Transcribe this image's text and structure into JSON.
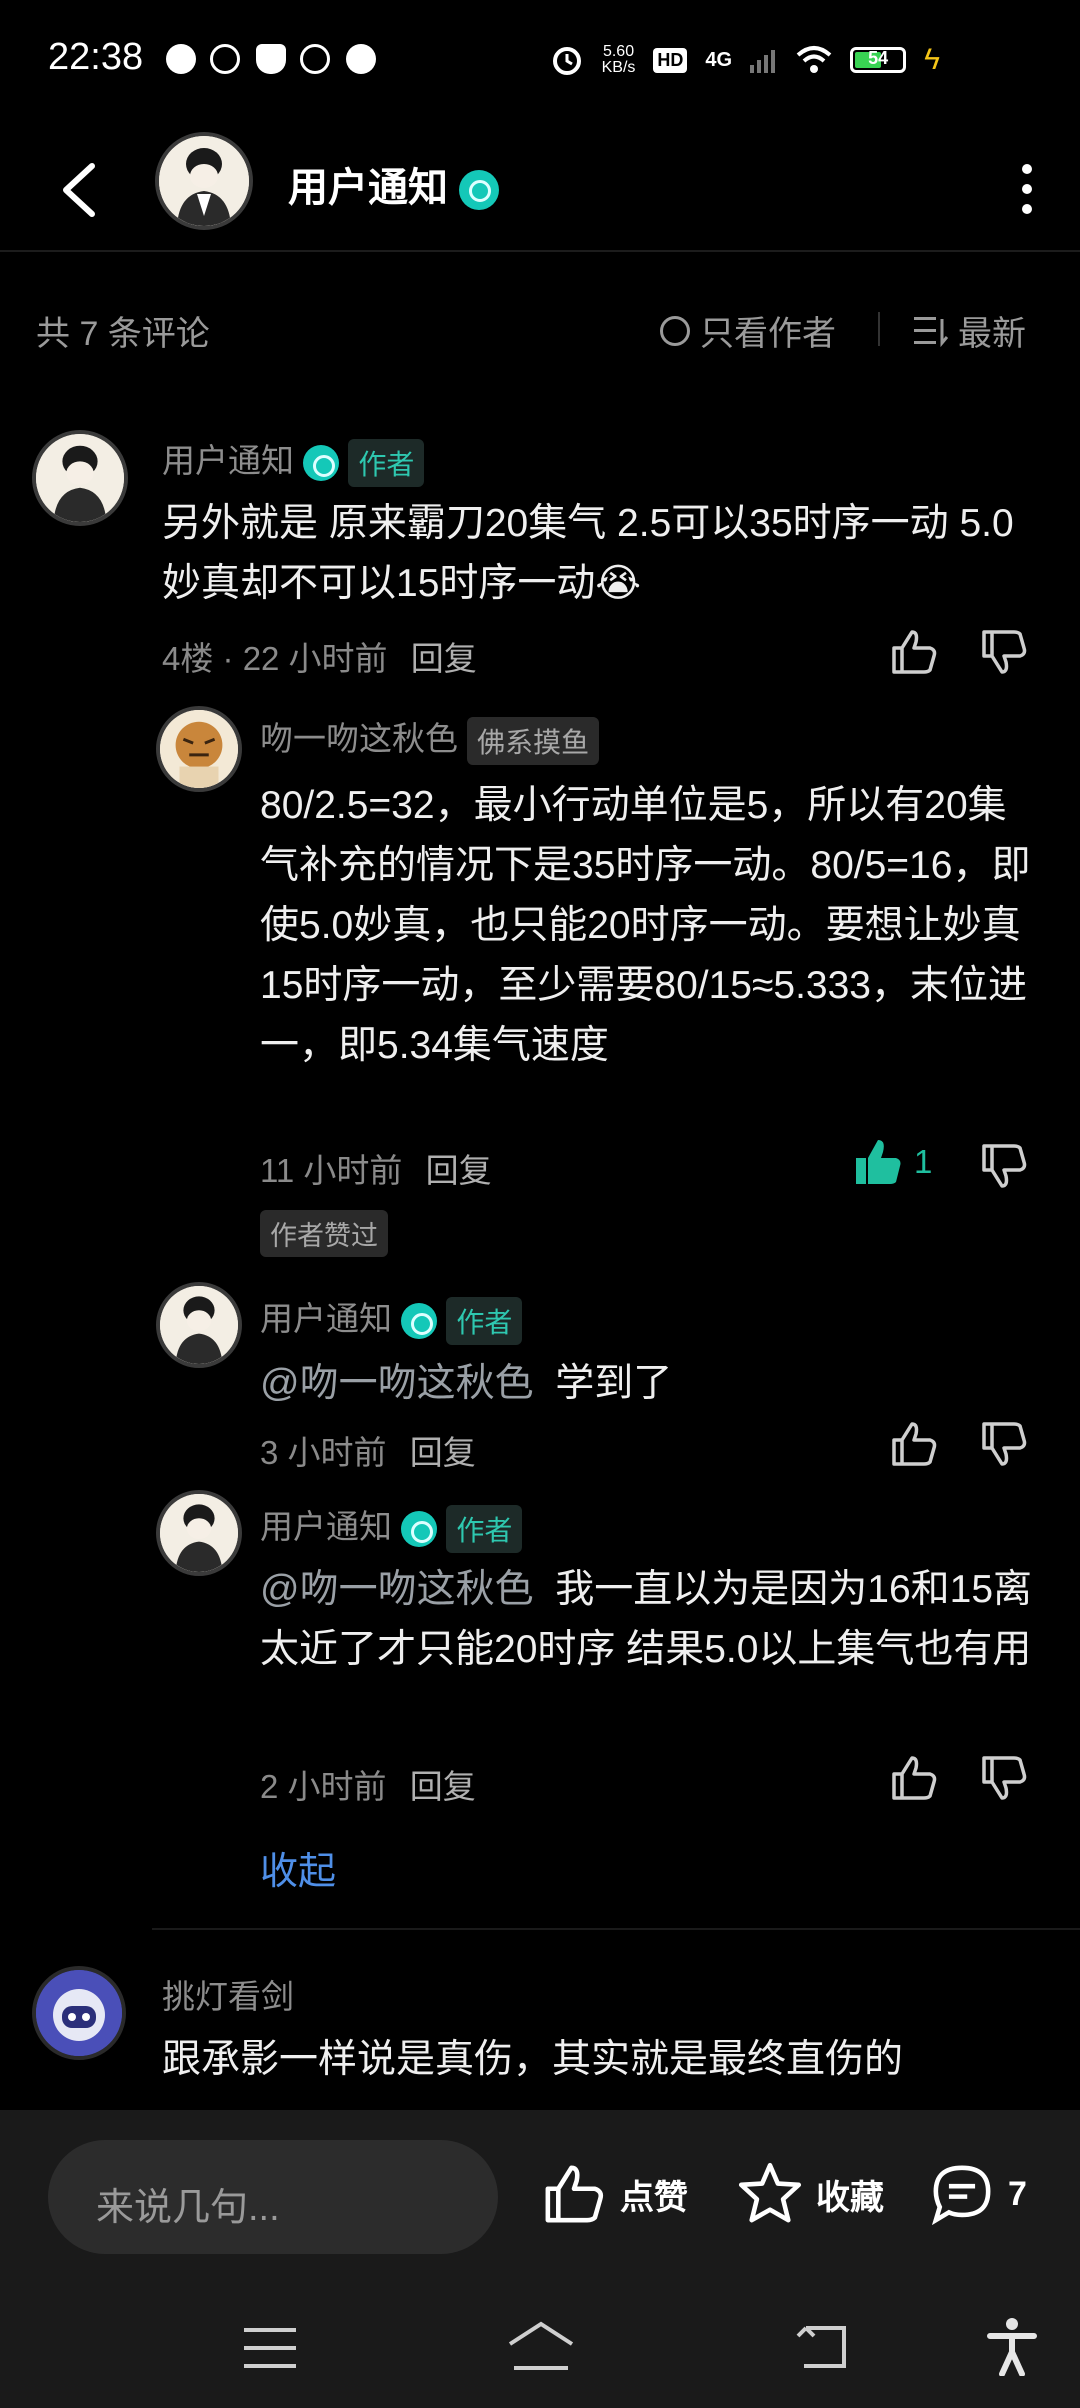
{
  "status_bar": {
    "time": "22:38",
    "net_speed_value": "5.60",
    "net_speed_unit": "KB/s",
    "hd": "HD",
    "network": "4G",
    "battery": "54"
  },
  "header": {
    "title": "用户通知"
  },
  "sort_bar": {
    "comment_count": "共 7 条评论",
    "author_only": "只看作者",
    "latest": "最新"
  },
  "comments": [
    {
      "author": "用户通知",
      "badge": "作者",
      "text": "另外就是 原来霸刀20集气 2.5可以35时序一动 5.0妙真却不可以15时序一动😭",
      "floor": "4楼",
      "time": "22 小时前",
      "reply": "回复",
      "replies": [
        {
          "author": "吻一吻这秋色",
          "badge": "佛系摸鱼",
          "text": "80/2.5=32，最小行动单位是5，所以有20集气补充的情况下是35时序一动。80/5=16，即使5.0妙真，也只能20时序一动。要想让妙真15时序一动，至少需要80/15≈5.333，末位进一，即5.34集气速度",
          "time": "11 小时前",
          "reply": "回复",
          "likes": "1",
          "author_liked": "作者赞过"
        },
        {
          "author": "用户通知",
          "badge": "作者",
          "mention": "@吻一吻这秋色",
          "text": "学到了",
          "time": "3 小时前",
          "reply": "回复"
        },
        {
          "author": "用户通知",
          "badge": "作者",
          "mention": "@吻一吻这秋色",
          "text": "我一直以为是因为16和15离太近了才只能20时序 结果5.0以上集气也有用",
          "time": "2 小时前",
          "reply": "回复"
        }
      ],
      "collapse": "收起"
    },
    {
      "author": "挑灯看剑",
      "text": "跟承影一样说是真伤，其实就是最终直伤的"
    }
  ],
  "bottom_bar": {
    "input_placeholder": "来说几句...",
    "like_label": "点赞",
    "favorite_label": "收藏",
    "comment_count": "7"
  },
  "colors": {
    "background": "#000000",
    "accent_teal": "#2ec8b0",
    "link_blue": "#4f8fe8",
    "bar_bg": "#1a1a1a"
  }
}
